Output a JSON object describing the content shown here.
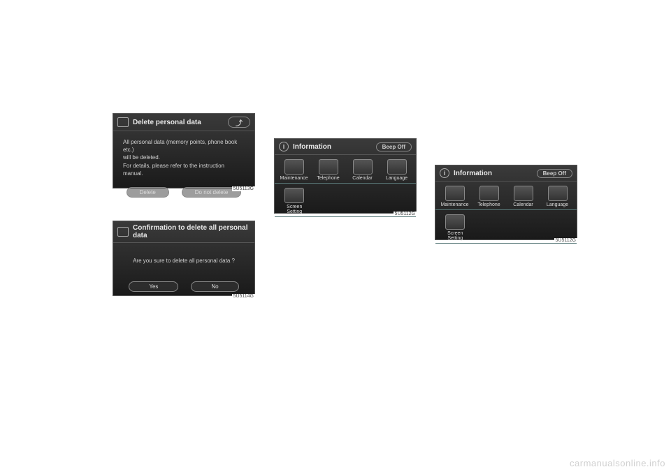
{
  "shot1": {
    "title": "Delete personal data",
    "body_line1": "All personal data (memory points, phone book etc.)",
    "body_line2": "will be deleted.",
    "body_line3": "For details, please refer to the instruction manual.",
    "btn_delete": "Delete",
    "btn_dont": "Do not delete",
    "caption": "5U5113G"
  },
  "shot2": {
    "title": "Confirmation to delete all personal data",
    "body": "Are you sure to delete all personal data ?",
    "btn_yes": "Yes",
    "btn_no": "No",
    "caption": "5U5114G"
  },
  "info": {
    "title": "Information",
    "beep": "Beep Off",
    "tiles": {
      "maintenance": "Maintenance",
      "telephone": "Telephone",
      "calendar": "Calendar",
      "language": "Language",
      "screen_setting": "Screen\nSetting"
    },
    "caption": "5U5112G"
  },
  "watermark": "carmanualsonline.info"
}
